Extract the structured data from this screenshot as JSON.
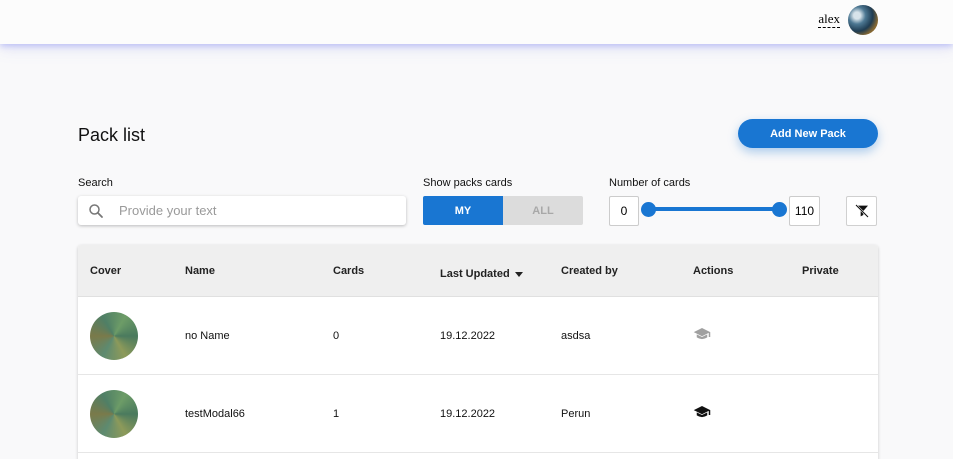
{
  "user": {
    "name": "alex"
  },
  "page": {
    "title": "Pack list",
    "add_button": "Add New Pack"
  },
  "filters": {
    "search_label": "Search",
    "search_placeholder": "Provide your text",
    "show_label": "Show packs cards",
    "show_options": [
      "MY",
      "ALL"
    ],
    "show_selected": "MY",
    "count_label": "Number of cards",
    "count_min": "0",
    "count_max": "110"
  },
  "table": {
    "headers": [
      "Cover",
      "Name",
      "Cards",
      "Last Updated",
      "Created by",
      "Actions",
      "Private"
    ],
    "rows": [
      {
        "name": "no Name",
        "cards": "0",
        "updated": "19.12.2022",
        "created_by": "asdsa",
        "action_icon": "learn-icon",
        "action_color": "#a0a0a0"
      },
      {
        "name": "testModal66",
        "cards": "1",
        "updated": "19.12.2022",
        "created_by": "Perun",
        "action_icon": "learn-icon",
        "action_color": "#111111"
      }
    ]
  },
  "colors": {
    "accent": "#1976d2",
    "background": "#f9f9fa"
  }
}
